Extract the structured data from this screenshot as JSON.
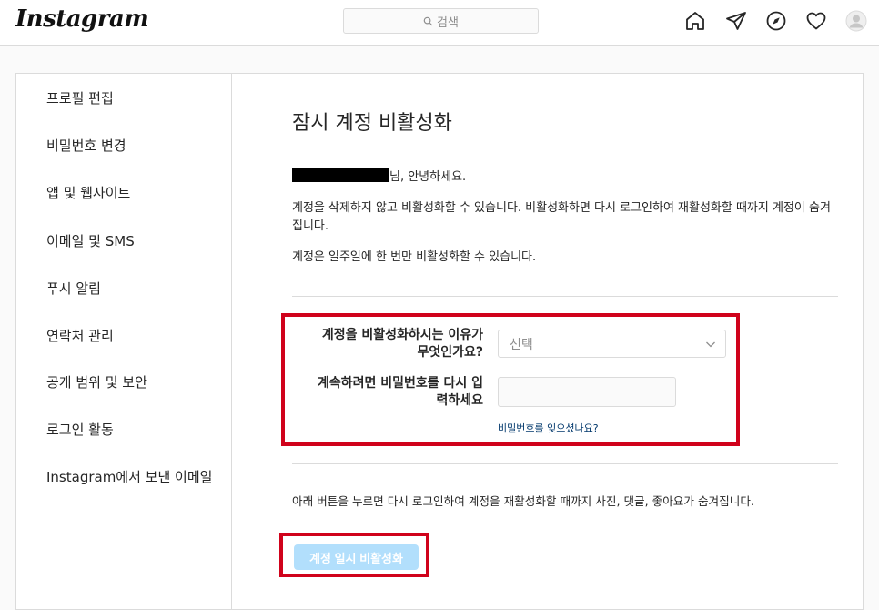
{
  "header": {
    "logo": "Instagram",
    "search_placeholder": "검색",
    "icons": [
      "home-icon",
      "direct-icon",
      "explore-icon",
      "activity-icon",
      "profile-avatar"
    ]
  },
  "sidebar": {
    "items": [
      {
        "label": "프로필 편집"
      },
      {
        "label": "비밀번호 변경"
      },
      {
        "label": "앱 및 웹사이트"
      },
      {
        "label": "이메일 및 SMS"
      },
      {
        "label": "푸시 알림"
      },
      {
        "label": "연락처 관리"
      },
      {
        "label": "공개 범위 및 보안"
      },
      {
        "label": "로그인 활동"
      },
      {
        "label": "Instagram에서 보낸 이메일"
      }
    ]
  },
  "main": {
    "title": "잠시 계정 비활성화",
    "greeting_suffix": "님, 안녕하세요.",
    "intro": "계정을 삭제하지 않고 비활성화할 수 있습니다. 비활성화하면 다시 로그인하여 재활성화할 때까지 계정이 숨겨집니다.",
    "limit_note": "계정은 일주일에 한 번만 비활성화할 수 있습니다.",
    "reason_label": "계정을 비활성화하시는 이유가 무엇인가요?",
    "reason_select_value": "선택",
    "password_label": "계속하려면 비밀번호를 다시 입력하세요",
    "password_value": "",
    "forgot_link": "비밀번호를 잊으셨나요?",
    "footer_note": "아래 버튼을 누르면 다시 로그인하여 계정을 재활성화할 때까지 사진, 댓글, 좋아요가 숨겨집니다.",
    "deactivate_button": "계정 일시 비활성화"
  },
  "colors": {
    "highlight": "#d0021b",
    "button_disabled": "#b2dffc",
    "link": "#00376b"
  }
}
